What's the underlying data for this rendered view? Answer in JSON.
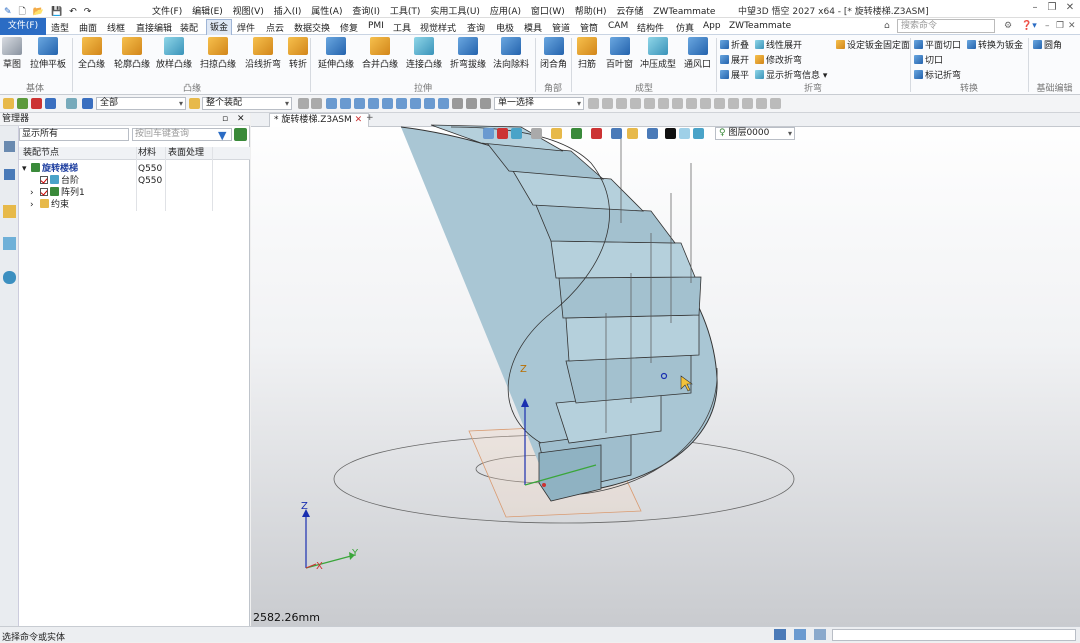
{
  "menubar": {
    "items": [
      "文件(F)",
      "编辑(E)",
      "视图(V)",
      "插入(I)",
      "属性(A)",
      "查询(I)",
      "工具(T)",
      "实用工具(U)",
      "应用(A)",
      "窗口(W)",
      "帮助(H)",
      "云存储",
      "ZWTeammate"
    ],
    "title": "中望3D 悟空 2027 x64  - [* 旋转楼梯.Z3ASM]"
  },
  "tabs": {
    "file": "文件(F)",
    "items": [
      "造型",
      "曲面",
      "线框",
      "直接编辑",
      "装配",
      "钣金",
      "焊件",
      "点云",
      "数据交换",
      "修复",
      "PMI",
      "工具",
      "视觉样式",
      "查询",
      "电极",
      "模具",
      "管道",
      "管筒",
      "CAM",
      "结构件",
      "仿真",
      "App",
      "ZWTeammate"
    ],
    "active": "钣金",
    "search_placeholder": "搜索命令"
  },
  "ribbon": {
    "basic": {
      "group": "基体",
      "buttons": [
        "草图",
        "拉伸平板"
      ]
    },
    "flange": {
      "group": "凸缘",
      "buttons": [
        "全凸缘",
        "轮廓凸缘",
        "放样凸缘",
        "扫掠凸缘",
        "沿线折弯",
        "转折"
      ]
    },
    "drawing": {
      "group": "拉伸",
      "buttons": [
        "延伸凸缘",
        "合并凸缘",
        "连接凸缘",
        "折弯拔缘",
        "法向除料"
      ]
    },
    "corner": {
      "group": "角部",
      "buttons": [
        "闭合角"
      ]
    },
    "forming": {
      "group": "成型",
      "buttons": [
        "扫筋",
        "百叶窗",
        "冲压成型",
        "通风口"
      ]
    },
    "bend": {
      "group": "折弯",
      "buttons": [
        "折叠",
        "展开",
        "展平",
        "线性展开",
        "修改折弯",
        "显示折弯信息"
      ],
      "extra": "设定钣金固定面"
    },
    "convert": {
      "group": "转换",
      "buttons": [
        "平面切口",
        "切口",
        "标记折弯",
        "转换为钣金"
      ]
    },
    "edit": {
      "group": "基础编辑",
      "buttons": [
        "圆角"
      ]
    }
  },
  "toolbar": {
    "filter_all": "全部",
    "assembly": "整个装配",
    "select_mode": "单一选择"
  },
  "manager": {
    "title": "管理器",
    "filter": "显示所有",
    "search_placeholder": "按回车键查询",
    "columns": [
      "装配节点",
      "材料",
      "表面处理"
    ],
    "rows": [
      {
        "name": "旋转楼梯",
        "material": "Q550",
        "level": 0
      },
      {
        "name": "台阶",
        "material": "Q550",
        "level": 1
      },
      {
        "name": "阵列1",
        "material": "",
        "level": 1
      },
      {
        "name": "约束",
        "material": "",
        "level": 1
      }
    ]
  },
  "viewport": {
    "tab": "* 旋转楼梯.Z3ASM",
    "layer": "图层0000",
    "measure": "2582.26mm",
    "axis_z": "Z",
    "axis_y": "Y",
    "axis_x": "X"
  },
  "status": {
    "text": "选择命令或实体"
  }
}
